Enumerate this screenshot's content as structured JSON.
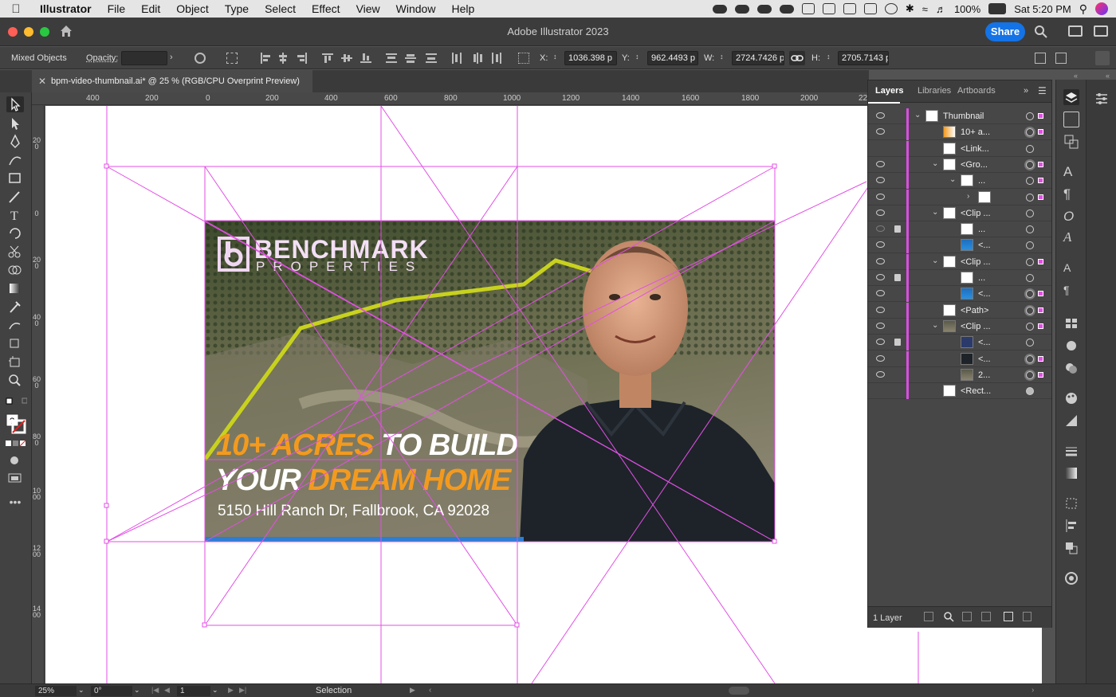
{
  "menubar": {
    "items": [
      "Illustrator",
      "File",
      "Edit",
      "Object",
      "Type",
      "Select",
      "Effect",
      "View",
      "Window",
      "Help"
    ],
    "battery": "100%",
    "clock": "Sat 5:20 PM"
  },
  "app": {
    "title": "Adobe Illustrator 2023",
    "share_label": "Share"
  },
  "control": {
    "selection_label": "Mixed Objects",
    "opacity_label": "Opacity:",
    "opacity_value": "",
    "x_label": "X:",
    "x_value": "1036.398 p",
    "y_label": "Y:",
    "y_value": "962.4493 p",
    "w_label": "W:",
    "w_value": "2724.7426 p",
    "h_label": "H:",
    "h_value": "2705.7143 p"
  },
  "document": {
    "tab_title": "bpm-video-thumbnail.ai* @ 25 % (RGB/CPU Overprint Preview)"
  },
  "ruler": {
    "h_ticks": [
      "400",
      "200",
      "0",
      "200",
      "400",
      "600",
      "800",
      "1000",
      "1200",
      "1400",
      "1600",
      "1800",
      "2000",
      "22"
    ],
    "v_ticks": [
      "200",
      "0",
      "200",
      "400",
      "600",
      "800",
      "1000",
      "1200",
      "1400"
    ]
  },
  "artwork": {
    "logo_main": "BENCHMARK",
    "logo_sub": "PROPERTIES",
    "headline_1a": "10+ ACRES",
    "headline_1b": "TO BUILD",
    "headline_2a": "YOUR",
    "headline_2b": "DREAM HOME",
    "address": "5150 Hill Ranch Dr, Fallbrook, CA 92028"
  },
  "layers_panel": {
    "tabs": [
      "Layers",
      "Libraries",
      "Artboards"
    ],
    "rows": [
      {
        "label": "Thumbnail"
      },
      {
        "label": "10+ a..."
      },
      {
        "label": "<Link..."
      },
      {
        "label": "<Gro..."
      },
      {
        "label": "..."
      },
      {
        "label": ""
      },
      {
        "label": "<Clip ..."
      },
      {
        "label": "..."
      },
      {
        "label": "<..."
      },
      {
        "label": "<Clip ..."
      },
      {
        "label": "..."
      },
      {
        "label": "<..."
      },
      {
        "label": "<Path>"
      },
      {
        "label": "<Clip ..."
      },
      {
        "label": "<..."
      },
      {
        "label": "<..."
      },
      {
        "label": "2..."
      },
      {
        "label": "<Rect..."
      }
    ],
    "footer_label": "1 Layer"
  },
  "status": {
    "zoom": "25%",
    "rotation": "0°",
    "artboard": "1",
    "tool": "Selection"
  },
  "colors": {
    "accent": "#1473e6",
    "guide": "#e34fe6",
    "headline_orange": "#f39a1e",
    "path_yellow": "#c8d21e"
  }
}
